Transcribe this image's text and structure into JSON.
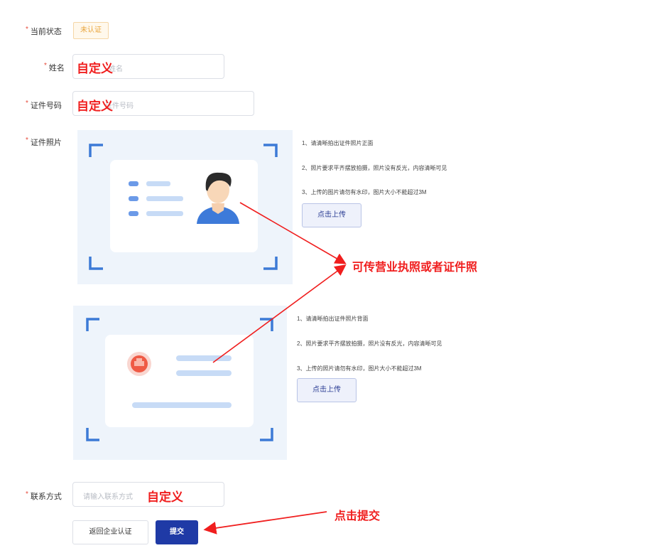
{
  "form": {
    "status": {
      "label": "当前状态",
      "value": "未认证"
    },
    "name": {
      "label": "姓名",
      "placeholder": "姓名",
      "annotation": "自定义"
    },
    "id_number": {
      "label": "证件号码",
      "placeholder": "证件号码",
      "annotation": "自定义"
    },
    "photo": {
      "label": "证件照片"
    },
    "contact": {
      "label": "联系方式",
      "placeholder": "请输入联系方式",
      "annotation": "自定义"
    }
  },
  "upload_front": {
    "tips": [
      "1、请清晰拍出证件照片正面",
      "2、照片要求平齐摆放拍摄，照片没有反光，内容清晰可见",
      "3、上传的图片请勿有水印，图片大小不能超过3M"
    ],
    "button": "点击上传"
  },
  "upload_back": {
    "tips": [
      "1、请清晰拍出证件照片背面",
      "2、照片要求平齐摆放拍摄，照片没有反光，内容清晰可见",
      "3、上传的照片请勿有水印，图片大小不能超过3M"
    ],
    "button": "点击上传"
  },
  "annotations": {
    "photo_note": "可传营业执照或者证件照",
    "submit_note": "点击提交"
  },
  "actions": {
    "back": "返回企业认证",
    "submit": "提交"
  },
  "colors": {
    "primary": "#1f3aa6",
    "annotation_red": "#f01e1e",
    "frame_blue": "#3c7ad6",
    "card_bg": "#eef4fb"
  }
}
